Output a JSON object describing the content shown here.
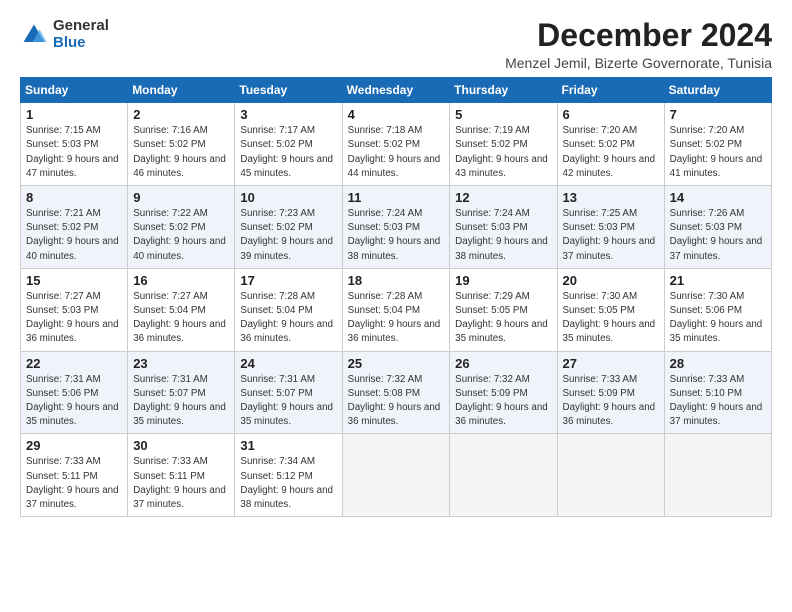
{
  "logo": {
    "general": "General",
    "blue": "Blue"
  },
  "title": "December 2024",
  "location": "Menzel Jemil, Bizerte Governorate, Tunisia",
  "days_of_week": [
    "Sunday",
    "Monday",
    "Tuesday",
    "Wednesday",
    "Thursday",
    "Friday",
    "Saturday"
  ],
  "weeks": [
    [
      {
        "day": "1",
        "sunrise": "7:15 AM",
        "sunset": "5:03 PM",
        "daylight": "9 hours and 47 minutes."
      },
      {
        "day": "2",
        "sunrise": "7:16 AM",
        "sunset": "5:02 PM",
        "daylight": "9 hours and 46 minutes."
      },
      {
        "day": "3",
        "sunrise": "7:17 AM",
        "sunset": "5:02 PM",
        "daylight": "9 hours and 45 minutes."
      },
      {
        "day": "4",
        "sunrise": "7:18 AM",
        "sunset": "5:02 PM",
        "daylight": "9 hours and 44 minutes."
      },
      {
        "day": "5",
        "sunrise": "7:19 AM",
        "sunset": "5:02 PM",
        "daylight": "9 hours and 43 minutes."
      },
      {
        "day": "6",
        "sunrise": "7:20 AM",
        "sunset": "5:02 PM",
        "daylight": "9 hours and 42 minutes."
      },
      {
        "day": "7",
        "sunrise": "7:20 AM",
        "sunset": "5:02 PM",
        "daylight": "9 hours and 41 minutes."
      }
    ],
    [
      {
        "day": "8",
        "sunrise": "7:21 AM",
        "sunset": "5:02 PM",
        "daylight": "9 hours and 40 minutes."
      },
      {
        "day": "9",
        "sunrise": "7:22 AM",
        "sunset": "5:02 PM",
        "daylight": "9 hours and 40 minutes."
      },
      {
        "day": "10",
        "sunrise": "7:23 AM",
        "sunset": "5:02 PM",
        "daylight": "9 hours and 39 minutes."
      },
      {
        "day": "11",
        "sunrise": "7:24 AM",
        "sunset": "5:03 PM",
        "daylight": "9 hours and 38 minutes."
      },
      {
        "day": "12",
        "sunrise": "7:24 AM",
        "sunset": "5:03 PM",
        "daylight": "9 hours and 38 minutes."
      },
      {
        "day": "13",
        "sunrise": "7:25 AM",
        "sunset": "5:03 PM",
        "daylight": "9 hours and 37 minutes."
      },
      {
        "day": "14",
        "sunrise": "7:26 AM",
        "sunset": "5:03 PM",
        "daylight": "9 hours and 37 minutes."
      }
    ],
    [
      {
        "day": "15",
        "sunrise": "7:27 AM",
        "sunset": "5:03 PM",
        "daylight": "9 hours and 36 minutes."
      },
      {
        "day": "16",
        "sunrise": "7:27 AM",
        "sunset": "5:04 PM",
        "daylight": "9 hours and 36 minutes."
      },
      {
        "day": "17",
        "sunrise": "7:28 AM",
        "sunset": "5:04 PM",
        "daylight": "9 hours and 36 minutes."
      },
      {
        "day": "18",
        "sunrise": "7:28 AM",
        "sunset": "5:04 PM",
        "daylight": "9 hours and 36 minutes."
      },
      {
        "day": "19",
        "sunrise": "7:29 AM",
        "sunset": "5:05 PM",
        "daylight": "9 hours and 35 minutes."
      },
      {
        "day": "20",
        "sunrise": "7:30 AM",
        "sunset": "5:05 PM",
        "daylight": "9 hours and 35 minutes."
      },
      {
        "day": "21",
        "sunrise": "7:30 AM",
        "sunset": "5:06 PM",
        "daylight": "9 hours and 35 minutes."
      }
    ],
    [
      {
        "day": "22",
        "sunrise": "7:31 AM",
        "sunset": "5:06 PM",
        "daylight": "9 hours and 35 minutes."
      },
      {
        "day": "23",
        "sunrise": "7:31 AM",
        "sunset": "5:07 PM",
        "daylight": "9 hours and 35 minutes."
      },
      {
        "day": "24",
        "sunrise": "7:31 AM",
        "sunset": "5:07 PM",
        "daylight": "9 hours and 35 minutes."
      },
      {
        "day": "25",
        "sunrise": "7:32 AM",
        "sunset": "5:08 PM",
        "daylight": "9 hours and 36 minutes."
      },
      {
        "day": "26",
        "sunrise": "7:32 AM",
        "sunset": "5:09 PM",
        "daylight": "9 hours and 36 minutes."
      },
      {
        "day": "27",
        "sunrise": "7:33 AM",
        "sunset": "5:09 PM",
        "daylight": "9 hours and 36 minutes."
      },
      {
        "day": "28",
        "sunrise": "7:33 AM",
        "sunset": "5:10 PM",
        "daylight": "9 hours and 37 minutes."
      }
    ],
    [
      {
        "day": "29",
        "sunrise": "7:33 AM",
        "sunset": "5:11 PM",
        "daylight": "9 hours and 37 minutes."
      },
      {
        "day": "30",
        "sunrise": "7:33 AM",
        "sunset": "5:11 PM",
        "daylight": "9 hours and 37 minutes."
      },
      {
        "day": "31",
        "sunrise": "7:34 AM",
        "sunset": "5:12 PM",
        "daylight": "9 hours and 38 minutes."
      },
      null,
      null,
      null,
      null
    ]
  ]
}
